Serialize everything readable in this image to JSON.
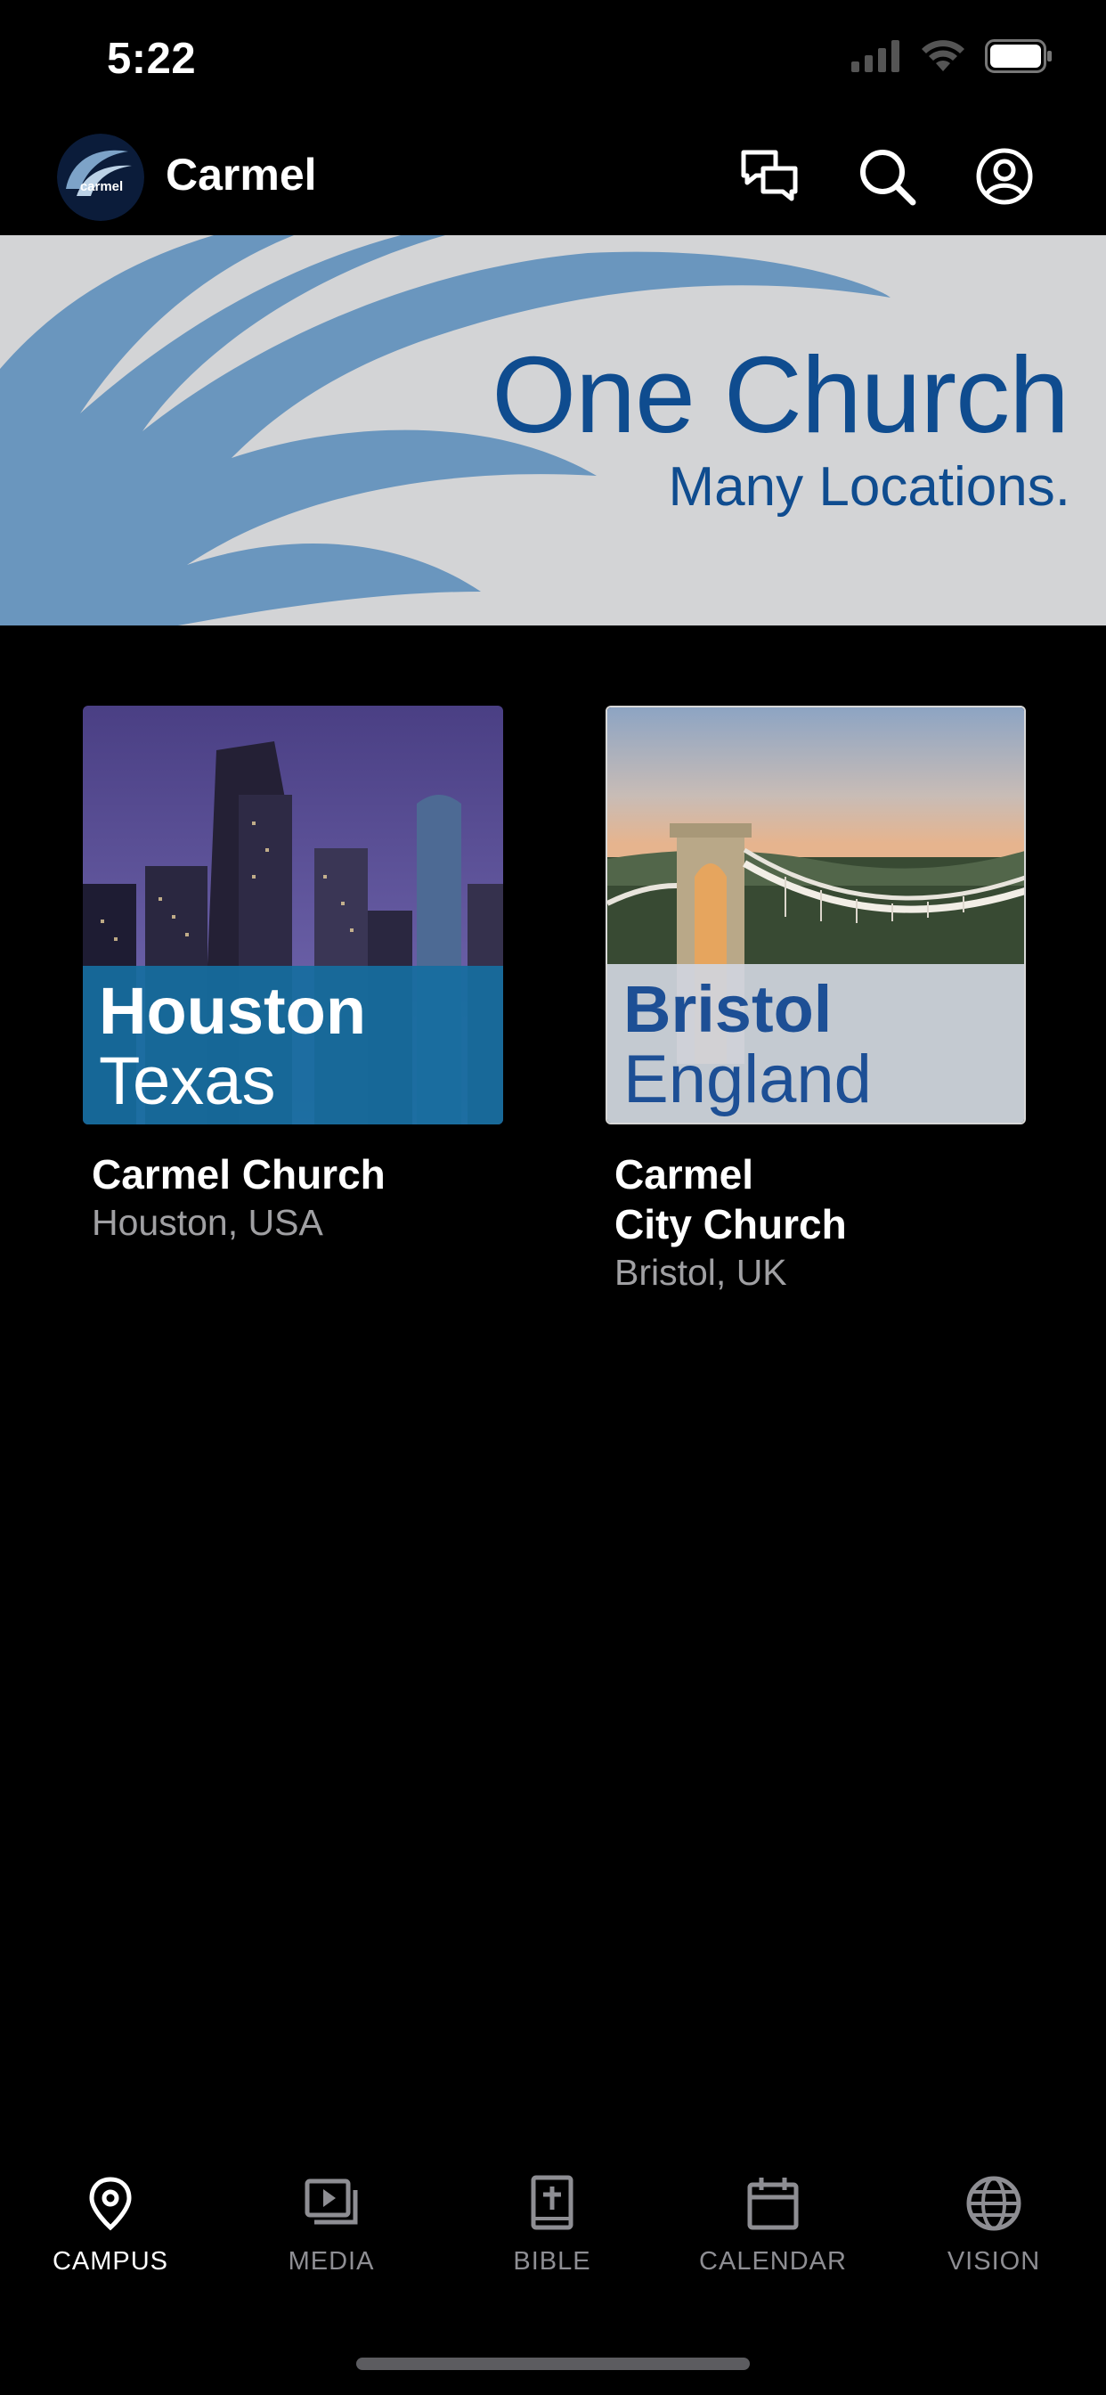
{
  "status_bar": {
    "time": "5:22"
  },
  "header": {
    "title": "Carmel",
    "logo_text": "carmel"
  },
  "banner": {
    "title": "One Church",
    "subtitle": "Many Locations."
  },
  "campuses": [
    {
      "thumb_line1": "Houston",
      "thumb_line2": "Texas",
      "name": "Carmel Church",
      "location": "Houston, USA"
    },
    {
      "thumb_line1": "Bristol",
      "thumb_line2": "England",
      "name": "Carmel\nCity Church",
      "location": "Bristol, UK"
    }
  ],
  "tabs": [
    {
      "label": "CAMPUS",
      "icon": "location-pin-icon",
      "active": true
    },
    {
      "label": "MEDIA",
      "icon": "media-play-icon",
      "active": false
    },
    {
      "label": "BIBLE",
      "icon": "bible-icon",
      "active": false
    },
    {
      "label": "CALENDAR",
      "icon": "calendar-icon",
      "active": false
    },
    {
      "label": "VISION",
      "icon": "globe-icon",
      "active": false
    }
  ],
  "colors": {
    "accent": "#0f4c8f",
    "banner_bg": "#d3d4d6",
    "houston_band": "#1a6c9c",
    "bristol_band": "#cfd4dc"
  }
}
